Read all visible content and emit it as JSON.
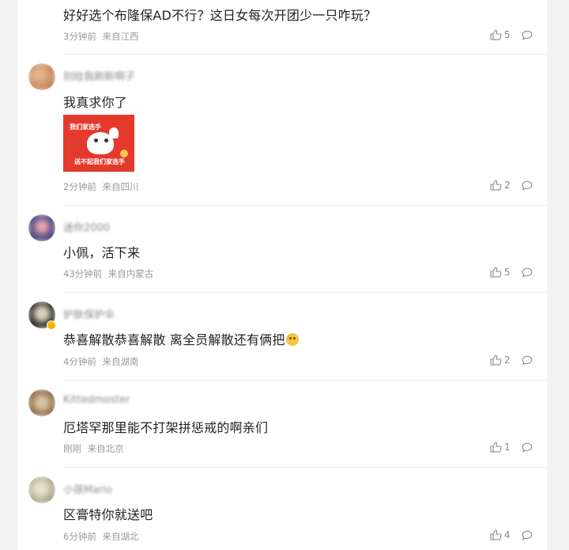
{
  "comments": [
    {
      "username": "",
      "text": "好好选个布隆保AD不行？这日女每次开团少一只咋玩？",
      "time": "3分钟前",
      "location": "来自江西",
      "likes": "5",
      "avatar_color": "#c9c9c9"
    },
    {
      "username": "别给我刷新啊子",
      "text": "我真求你了",
      "time": "2分钟前",
      "location": "来自四川",
      "likes": "2",
      "avatar_color": "#d8a37a",
      "sticker": {
        "top_text": "我们家选手",
        "bottom_text": "送不起我们家选手"
      }
    },
    {
      "username": "迷你2000",
      "text": "小佩，活下来",
      "time": "43分钟前",
      "location": "来自内蒙古",
      "likes": "5",
      "avatar_color": "#5a4f7a"
    },
    {
      "username": "护肤保护伞",
      "text": "恭喜解散恭喜解散 离全员解散还有俩把",
      "time": "4分钟前",
      "location": "来自湖南",
      "likes": "2",
      "avatar_color": "#3a3a36",
      "emoji": "scared-face-emoji"
    },
    {
      "username": "Kittedmoster",
      "text": "厄塔罕那里能不打架拼惩戒的啊亲们",
      "time": "刚刚",
      "location": "来自北京",
      "likes": "1",
      "avatar_color": "#b89672"
    },
    {
      "username": "小孩Mario",
      "text": "区膏特你就送吧",
      "time": "6分钟前",
      "location": "来自湖北",
      "likes": "4",
      "avatar_color": "#b9b79a"
    }
  ],
  "icons": {
    "like": "thumbs-up-icon",
    "reply": "comment-bubble-icon"
  },
  "colors": {
    "text": "#222222",
    "meta": "#9a9a9a",
    "background": "#f2f2f2"
  }
}
